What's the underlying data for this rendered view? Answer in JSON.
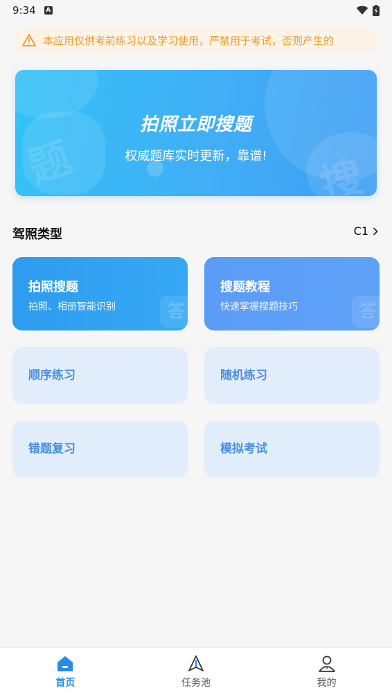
{
  "status_bar": {
    "time": "9:34",
    "notif_glyph": "A"
  },
  "notice": {
    "icon": "warning-icon",
    "text": "本应用仅供考前练习以及学习使用，严禁用于考试，否则产生的"
  },
  "banner": {
    "title": "拍照立即搜题",
    "subtitle": "权威题库实时更新，靠谱!"
  },
  "license_section": {
    "title": "驾照类型",
    "selected": "C1"
  },
  "cards": {
    "photo_search": {
      "title": "拍照搜题",
      "desc": "拍照、相册智能识别",
      "deco": "答"
    },
    "tutorial": {
      "title": "搜题教程",
      "desc": "快速掌握搜题技巧",
      "deco": "答"
    },
    "sequential": {
      "label": "顺序练习"
    },
    "random": {
      "label": "随机练习"
    },
    "wrong_review": {
      "label": "错题复习"
    },
    "mock_exam": {
      "label": "模拟考试"
    }
  },
  "bottom_nav": {
    "home": {
      "label": "首页",
      "active": true
    },
    "tasks": {
      "label": "任务池",
      "active": false
    },
    "mine": {
      "label": "我的",
      "active": false
    }
  },
  "colors": {
    "accent": "#2a8ae8",
    "notice_text": "#f09a2a"
  }
}
